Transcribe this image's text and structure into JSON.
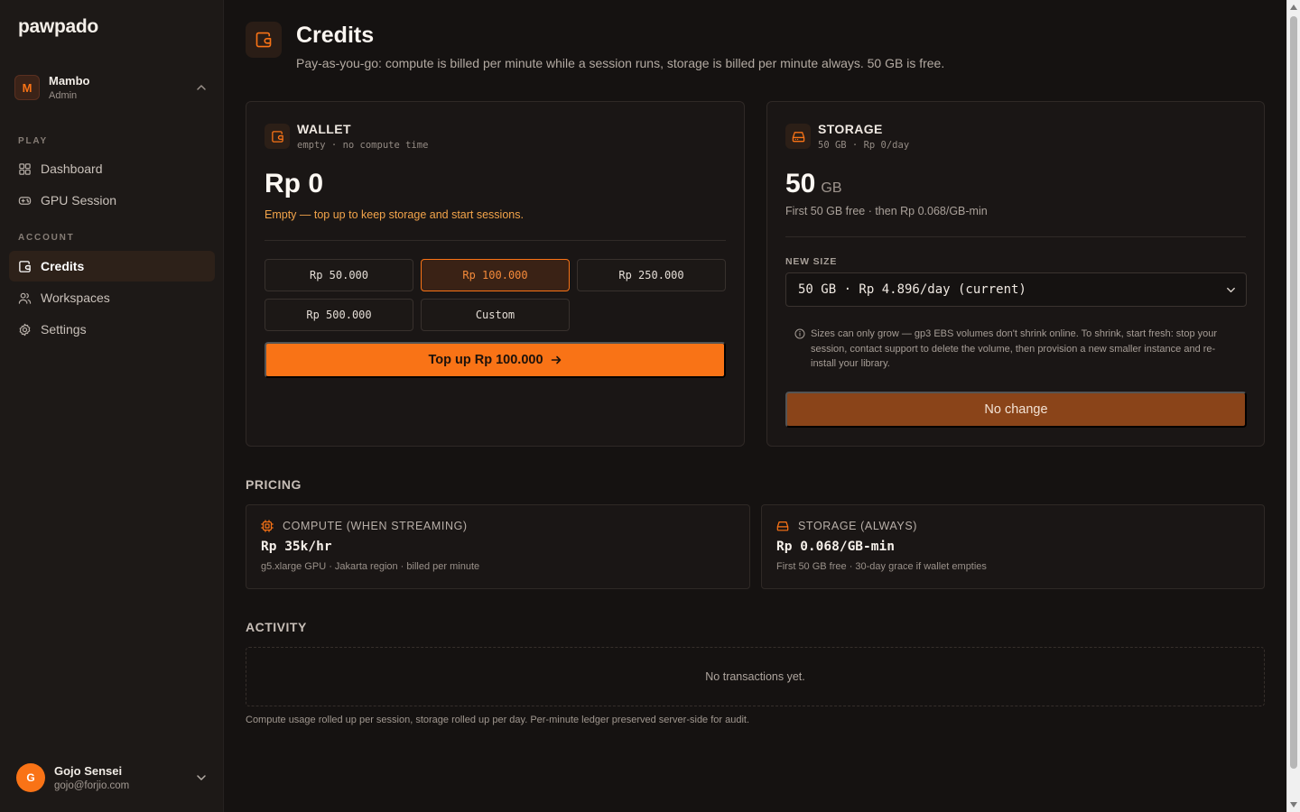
{
  "app": {
    "logo": "pawpado"
  },
  "org": {
    "initial": "M",
    "name": "Mambo",
    "role": "Admin"
  },
  "nav": {
    "play_label": "PLAY",
    "account_label": "ACCOUNT",
    "items": [
      {
        "label": "Dashboard",
        "icon": "grid-icon"
      },
      {
        "label": "GPU Session",
        "icon": "gamepad-icon"
      },
      {
        "label": "Credits",
        "icon": "wallet-icon",
        "active": true
      },
      {
        "label": "Workspaces",
        "icon": "users-icon"
      },
      {
        "label": "Settings",
        "icon": "gear-icon"
      }
    ]
  },
  "user": {
    "initial": "G",
    "name": "Gojo Sensei",
    "email": "gojo@forjio.com"
  },
  "header": {
    "title": "Credits",
    "subtitle": "Pay-as-you-go: compute is billed per minute while a session runs, storage is billed per minute always. 50 GB is free."
  },
  "wallet": {
    "title": "WALLET",
    "subtitle": "empty · no compute time",
    "balance": "Rp 0",
    "warning": "Empty — top up to keep storage and start sessions.",
    "amounts": [
      "Rp 50.000",
      "Rp 100.000",
      "Rp 250.000",
      "Rp 500.000",
      "Custom"
    ],
    "selected_index": 1,
    "topup_label": "Top up Rp 100.000"
  },
  "storage": {
    "title": "STORAGE",
    "subtitle": "50 GB · Rp 0/day",
    "size": "50",
    "unit": "GB",
    "pricing_line": "First 50 GB free · then Rp 0.068/GB-min",
    "new_size_label": "NEW SIZE",
    "selected_option": "50 GB · Rp 4.896/day (current)",
    "note": "Sizes can only grow — gp3 EBS volumes don't shrink online. To shrink, start fresh: stop your session, contact support to delete the volume, then provision a new smaller instance and re-install your library.",
    "button_label": "No change"
  },
  "pricing": {
    "title": "PRICING",
    "compute": {
      "label": "COMPUTE (WHEN STREAMING)",
      "value": "Rp 35k/hr",
      "detail": "g5.xlarge GPU · Jakarta region · billed per minute"
    },
    "storage": {
      "label": "STORAGE (ALWAYS)",
      "value": "Rp 0.068/GB-min",
      "detail": "First 50 GB free · 30-day grace if wallet empties"
    }
  },
  "activity": {
    "title": "ACTIVITY",
    "empty": "No transactions yet.",
    "footnote": "Compute usage rolled up per session, storage rolled up per day. Per-minute ledger preserved server-side for audit."
  },
  "colors": {
    "accent": "#f97316",
    "background": "#151211",
    "sidebar": "#1d1917",
    "warning": "#f3a44a"
  }
}
